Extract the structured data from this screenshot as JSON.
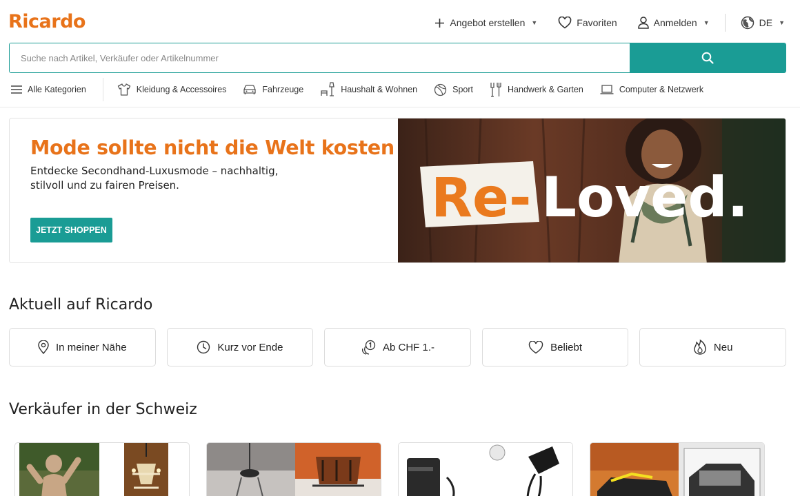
{
  "brand": {
    "logo": "Ricardo",
    "accent": "#e8731a",
    "teal": "#1a9c95"
  },
  "topnav": {
    "create": "Angebot erstellen",
    "favorites": "Favoriten",
    "login": "Anmelden",
    "language": "DE"
  },
  "search": {
    "placeholder": "Suche nach Artikel, Verkäufer oder Artikelnummer",
    "icon": "search-icon"
  },
  "categories": {
    "all": "Alle Kategorien",
    "items": [
      {
        "label": "Kleidung & Accessoires",
        "icon": "shirt-icon"
      },
      {
        "label": "Fahrzeuge",
        "icon": "car-icon"
      },
      {
        "label": "Haushalt & Wohnen",
        "icon": "lamp-icon"
      },
      {
        "label": "Sport",
        "icon": "ball-icon"
      },
      {
        "label": "Handwerk & Garten",
        "icon": "tools-icon"
      },
      {
        "label": "Computer & Netzwerk",
        "icon": "laptop-icon"
      }
    ]
  },
  "banner": {
    "headline": "Mode sollte nicht die Welt kosten",
    "text": "Entdecke Secondhand-Luxusmode – nachhaltig, stilvoll und zu fairen Preisen.",
    "button": "JETZT SHOPPEN",
    "image_text_re": "Re-",
    "image_text_loved": "Loved."
  },
  "aktuell": {
    "title": "Aktuell auf Ricardo",
    "chips": [
      {
        "label": "In meiner Nähe",
        "icon": "location-pin-icon"
      },
      {
        "label": "Kurz vor Ende",
        "icon": "clock-icon"
      },
      {
        "label": "Ab CHF 1.-",
        "icon": "one-franc-icon"
      },
      {
        "label": "Beliebt",
        "icon": "heart-icon"
      },
      {
        "label": "Neu",
        "icon": "flame-icon"
      }
    ]
  },
  "sellers": {
    "title": "Verkäufer in der Schweiz"
  }
}
